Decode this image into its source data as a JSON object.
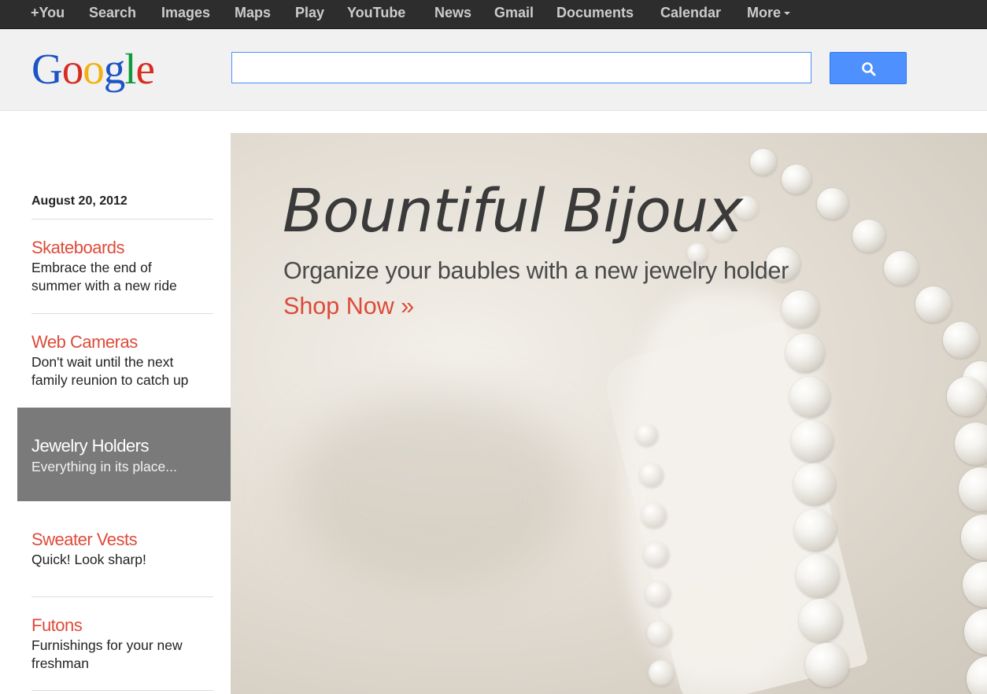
{
  "topnav": {
    "items": [
      "+You",
      "Search",
      "Images",
      "Maps",
      "Play",
      "YouTube",
      "News",
      "Gmail",
      "Documents",
      "Calendar",
      "More"
    ]
  },
  "header": {
    "logo": "Google",
    "search_value": "",
    "search_button_icon": "magnifier-icon"
  },
  "sidebar": {
    "date": "August 20, 2012",
    "items": [
      {
        "title": "Skateboards",
        "desc_line1": "Embrace the end of",
        "desc_line2": "summer with a new ride"
      },
      {
        "title": "Web Cameras",
        "desc_line1": "Don't wait until the next",
        "desc_line2": "family reunion to catch up"
      },
      {
        "title": "Jewelry Holders",
        "desc_line1": "Everything in its place...",
        "desc_line2": ""
      },
      {
        "title": "Sweater Vests",
        "desc_line1": "Quick! Look sharp!",
        "desc_line2": ""
      },
      {
        "title": "Futons",
        "desc_line1": "Furnishings for your new",
        "desc_line2": "freshman"
      }
    ],
    "active_index": 2
  },
  "hero": {
    "headline": "Bountiful Bijoux",
    "subline": "Organize your baubles with a new jewelry holder",
    "cta": "Shop Now »"
  },
  "colors": {
    "topbar": "#2d2d2d",
    "link_red": "#dd4b39",
    "search_blue": "#4d90fe",
    "active_tab": "#7a7a7a"
  }
}
